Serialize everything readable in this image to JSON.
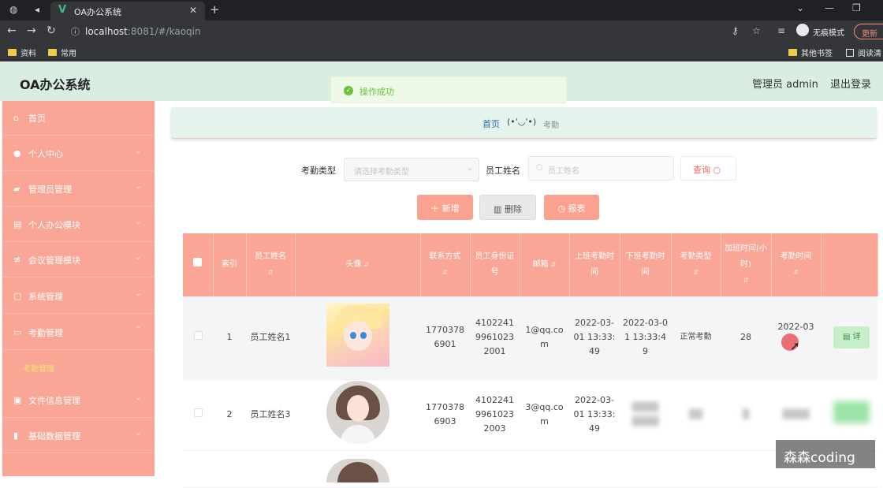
{
  "browser": {
    "tab_title": "OA办公系统",
    "url_host": "localhost",
    "url_path": ":8081/#/kaoqin",
    "incognito_label": "无痕模式",
    "update_label": "更新",
    "bookmarks": [
      "资料",
      "常用"
    ],
    "other_bookmarks": "其他书签",
    "reading_list": "阅读清"
  },
  "header": {
    "app_title": "OA办公系统",
    "admin_label": "管理员 admin",
    "logout_label": "退出登录"
  },
  "toast": {
    "message": "操作成功"
  },
  "sidebar": {
    "items": [
      {
        "label": "首页",
        "icon": "home-icon"
      },
      {
        "label": "个人中心",
        "icon": "user-icon"
      },
      {
        "label": "管理员管理",
        "icon": "briefcase-icon"
      },
      {
        "label": "个人办公模块",
        "icon": "document-icon"
      },
      {
        "label": "会议管理模块",
        "icon": "sliders-icon"
      },
      {
        "label": "系统管理",
        "icon": "square-icon"
      },
      {
        "label": "考勤管理",
        "icon": "card-icon"
      },
      {
        "label": "文件信息管理",
        "icon": "picture-icon"
      },
      {
        "label": "基础数据管理",
        "icon": "chart-icon"
      }
    ],
    "active_sub": "考勤管理"
  },
  "breadcrumb": {
    "home": "首页",
    "face": "(•'◡'•)",
    "current": "考勤"
  },
  "search": {
    "type_label": "考勤类型",
    "type_placeholder": "请选择考勤类型",
    "name_label": "员工姓名",
    "name_placeholder": "员工姓名",
    "query_button": "查询"
  },
  "actions": {
    "add": "新增",
    "delete": "删除",
    "report": "报表"
  },
  "table": {
    "headers": [
      "索引",
      "员工姓名",
      "头像",
      "联系方式",
      "员工身份证号",
      "邮箱",
      "上班考勤时间",
      "下班考勤时间",
      "考勤类型",
      "加班时间(小时)",
      "考勤时间"
    ],
    "rows": [
      {
        "index": "1",
        "name": "员工姓名1",
        "phone": "17703786901",
        "id_card": "410224199610232001",
        "email": "1@qq.com",
        "in_time": "2022-03-01 13:33:49",
        "out_time": "2022-03-01 13:33:49",
        "type": "正常考勤",
        "overtime": "28",
        "date": "2022-03",
        "detail": "详"
      },
      {
        "index": "2",
        "name": "员工姓名3",
        "phone": "17703786903",
        "id_card": "410224199610232003",
        "email": "3@qq.com",
        "in_time": "2022-03-01 13:33:49"
      }
    ]
  },
  "watermark": "森森coding"
}
